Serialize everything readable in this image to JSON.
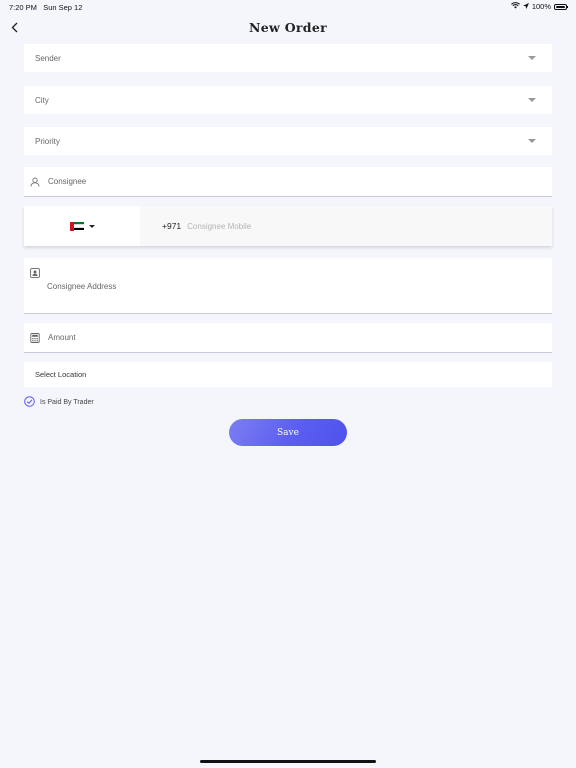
{
  "status_bar": {
    "time": "7:20 PM",
    "date": "Sun Sep 12",
    "battery_percent": "100%",
    "battery_level": 1.0
  },
  "nav": {
    "title": "New Order",
    "back_icon": "chevron-left-icon"
  },
  "form": {
    "sender": {
      "label": "Sender",
      "icon": "caret-down-icon"
    },
    "city": {
      "label": "City",
      "icon": "caret-down-icon"
    },
    "priority": {
      "label": "Priority",
      "icon": "caret-down-icon"
    },
    "consignee": {
      "label": "Consignee",
      "icon": "user-icon"
    },
    "phone": {
      "country_flag": "uae-flag-icon",
      "dial_code": "+971",
      "placeholder": "Consignee Mobile",
      "value": ""
    },
    "address": {
      "label": "Consignee Address",
      "icon": "contact-card-icon"
    },
    "amount": {
      "label": "Amount",
      "icon": "calculator-icon"
    },
    "location": {
      "label": "Select Location"
    },
    "paid_by_trader": {
      "label": "Is Paid By Trader",
      "checked": true,
      "icon": "check-circle-icon"
    },
    "save_label": "Save"
  },
  "colors": {
    "background": "#f4f6fc",
    "accent": "#5b5ef0",
    "field_bg": "#ffffff",
    "underline": "#ccc8dc"
  }
}
